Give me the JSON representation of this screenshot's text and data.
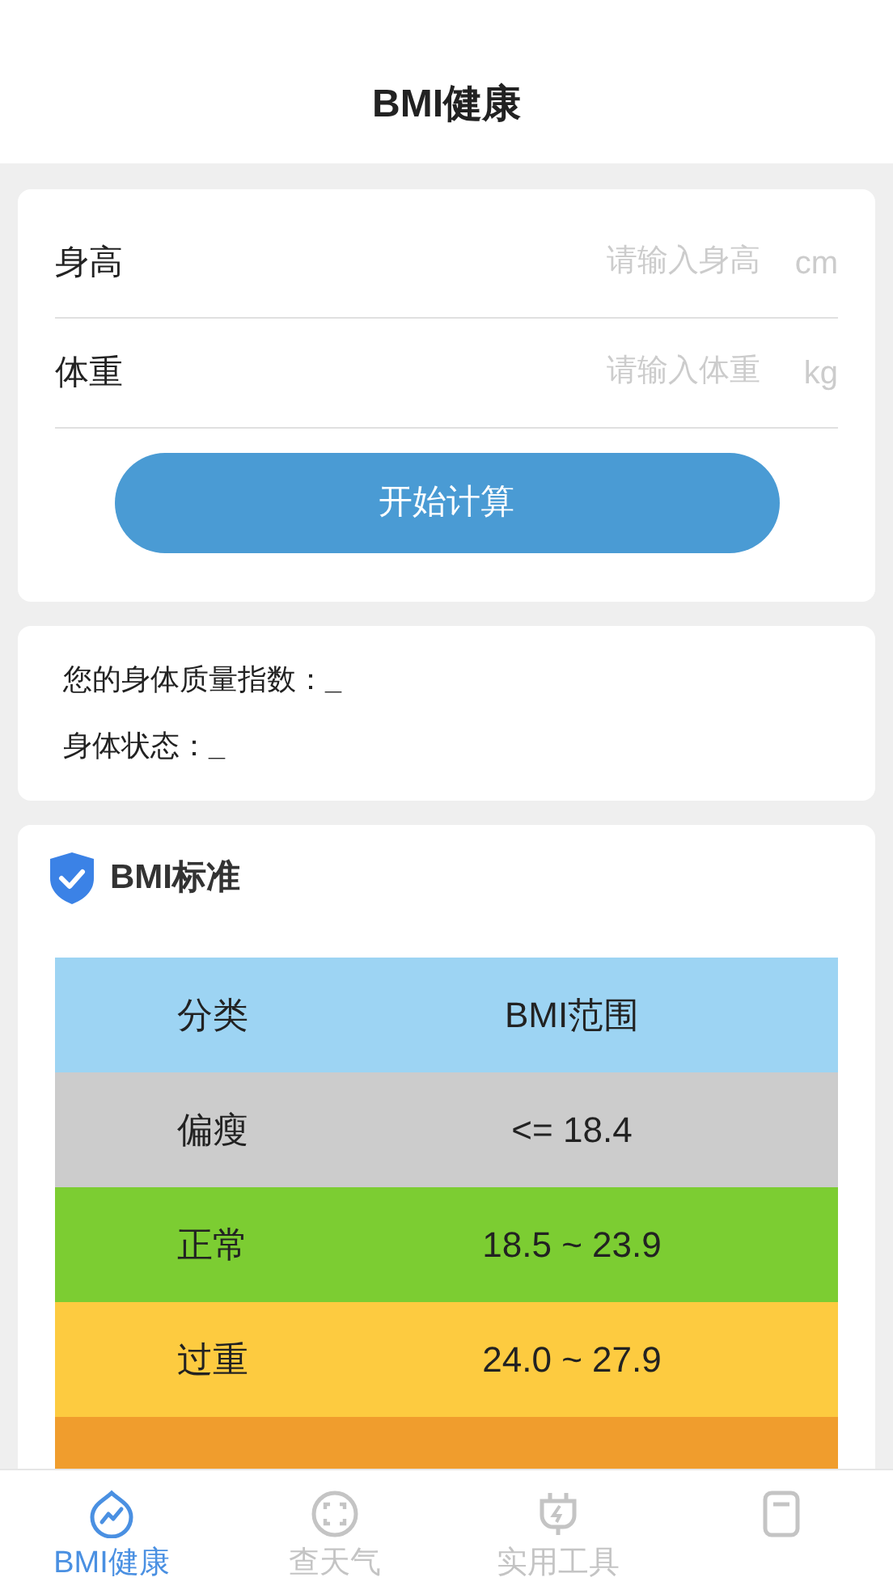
{
  "header": {
    "title": "BMI健康"
  },
  "form": {
    "fields": [
      {
        "label": "身高",
        "placeholder": "请输入身高",
        "unit": "cm"
      },
      {
        "label": "体重",
        "placeholder": "请输入体重",
        "unit": "kg"
      }
    ],
    "button": "开始计算"
  },
  "result": {
    "lines": [
      {
        "label": "您的身体质量指数：",
        "value": "_"
      },
      {
        "label": "身体状态：",
        "value": "_"
      }
    ]
  },
  "standard": {
    "title": "BMI标准",
    "columns": [
      "分类",
      "BMI范围"
    ],
    "rows": [
      {
        "category": "偏瘦",
        "range": "<= 18.4",
        "color": "#cccccc"
      },
      {
        "category": "正常",
        "range": "18.5 ~ 23.9",
        "color": "#7ccd32"
      },
      {
        "category": "过重",
        "range": "24.0 ~ 27.9",
        "color": "#fdcb40"
      },
      {
        "color": "#f09d2d"
      }
    ]
  },
  "tab_bar": [
    {
      "label": "BMI健康",
      "selected": true
    },
    {
      "label": "查天气",
      "selected": false
    },
    {
      "label": "实用工具",
      "selected": false
    },
    {
      "selected": false
    }
  ]
}
